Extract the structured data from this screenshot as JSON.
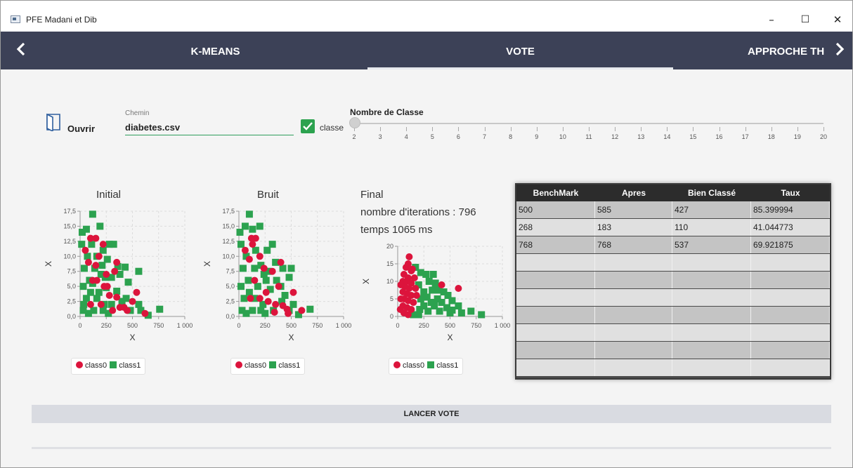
{
  "window": {
    "title": "PFE Madani et Dib",
    "minimize": "–",
    "maximize": "☐",
    "close": "✕"
  },
  "nav": {
    "tabs": [
      "K-MEANS",
      "VOTE",
      "APPROCHE TH"
    ],
    "active_tab": "VOTE",
    "prev_arrow": "‹",
    "next_arrow": "›"
  },
  "controls": {
    "open_label": "Ouvrir",
    "path_caption": "Chemin",
    "path_value": "diabetes.csv",
    "class_checkbox_label": "classe",
    "class_checked": true,
    "slider_title": "Nombre de Classe",
    "slider_min": 2,
    "slider_max": 20,
    "slider_value": 2,
    "slider_ticks": [
      "2",
      "3",
      "4",
      "5",
      "6",
      "7",
      "8",
      "9",
      "10",
      "11",
      "12",
      "13",
      "14",
      "15",
      "16",
      "17",
      "18",
      "19",
      "20"
    ]
  },
  "colors": {
    "accent": "#2ca24f",
    "navbar": "#3c4157",
    "class0": "#dc143c",
    "class1": "#2ca24f"
  },
  "chart_data": [
    {
      "type": "scatter",
      "title": "Initial",
      "xlabel": "X",
      "ylabel": "X",
      "xlim": [
        0,
        1000
      ],
      "ylim": [
        0,
        17.5
      ],
      "x_ticks": [
        "0",
        "250",
        "500",
        "750",
        "1 000"
      ],
      "y_ticks": [
        "0,0",
        "2,5",
        "5,0",
        "7,5",
        "10,0",
        "12,5",
        "15,0",
        "17,5"
      ],
      "grid": true,
      "legend": "bottom",
      "series": [
        {
          "name": "class0",
          "marker": "circle",
          "points": [
            [
              100,
              13
            ],
            [
              150,
              13
            ],
            [
              220,
              12
            ],
            [
              350,
              9
            ],
            [
              180,
              10
            ],
            [
              250,
              7
            ],
            [
              330,
              7.5
            ],
            [
              420,
              1.5
            ],
            [
              540,
              4
            ],
            [
              620,
              0.5
            ],
            [
              280,
              3.5
            ],
            [
              310,
              1
            ],
            [
              450,
              1
            ],
            [
              200,
              2
            ],
            [
              120,
              6
            ],
            [
              230,
              5
            ],
            [
              50,
              11
            ],
            [
              80,
              9
            ],
            [
              160,
              6
            ],
            [
              260,
              5
            ],
            [
              350,
              3.2
            ],
            [
              380,
              1.5
            ],
            [
              100,
              2
            ],
            [
              500,
              2.5
            ],
            [
              150,
              8.5
            ]
          ]
        },
        {
          "name": "class1",
          "marker": "square",
          "points": [
            [
              120,
              17
            ],
            [
              190,
              15
            ],
            [
              20,
              14
            ],
            [
              60,
              14.5
            ],
            [
              110,
              12
            ],
            [
              280,
              12
            ],
            [
              320,
              12
            ],
            [
              220,
              11
            ],
            [
              260,
              9.5
            ],
            [
              360,
              8.3
            ],
            [
              430,
              8.2
            ],
            [
              560,
              7.5
            ],
            [
              380,
              7
            ],
            [
              300,
              6.5
            ],
            [
              460,
              5.7
            ],
            [
              250,
              4.8
            ],
            [
              350,
              4.2
            ],
            [
              440,
              3
            ],
            [
              560,
              2
            ],
            [
              760,
              1.2
            ],
            [
              650,
              0.2
            ],
            [
              70,
              10
            ],
            [
              160,
              10
            ],
            [
              40,
              8
            ],
            [
              140,
              8
            ],
            [
              200,
              7
            ],
            [
              90,
              6
            ],
            [
              180,
              4
            ],
            [
              60,
              3
            ],
            [
              30,
              1
            ],
            [
              130,
              1
            ],
            [
              230,
              2
            ],
            [
              300,
              2
            ],
            [
              400,
              2.5
            ],
            [
              480,
              1
            ],
            [
              580,
              1
            ],
            [
              30,
              5
            ],
            [
              100,
              4
            ],
            [
              160,
              3
            ],
            [
              220,
              1
            ],
            [
              15,
              12
            ],
            [
              35,
              2
            ],
            [
              80,
              0.5
            ],
            [
              120,
              5.5
            ],
            [
              270,
              0.5
            ],
            [
              210,
              8.5
            ],
            [
              240,
              6.5
            ]
          ]
        }
      ]
    },
    {
      "type": "scatter",
      "title": "Bruit",
      "xlabel": "X",
      "ylabel": "X",
      "xlim": [
        0,
        1000
      ],
      "ylim": [
        0,
        17.5
      ],
      "x_ticks": [
        "0",
        "250",
        "500",
        "750",
        "1 000"
      ],
      "y_ticks": [
        "0,0",
        "2,5",
        "5,0",
        "7,5",
        "10,0",
        "12,5",
        "15,0",
        "17,5"
      ],
      "grid": true,
      "legend": "bottom",
      "series": [
        {
          "name": "class0",
          "marker": "circle",
          "points": [
            [
              120,
              13
            ],
            [
              160,
              13
            ],
            [
              130,
              12
            ],
            [
              400,
              9
            ],
            [
              240,
              8
            ],
            [
              320,
              7.5
            ],
            [
              150,
              6
            ],
            [
              380,
              5
            ],
            [
              520,
              4
            ],
            [
              460,
              1.2
            ],
            [
              600,
              1
            ],
            [
              420,
              1.8
            ],
            [
              340,
              0.7
            ],
            [
              280,
              2.5
            ],
            [
              200,
              10
            ],
            [
              100,
              9.5
            ],
            [
              60,
              11
            ],
            [
              260,
              4
            ],
            [
              200,
              3
            ],
            [
              350,
              2
            ],
            [
              110,
              3
            ],
            [
              470,
              0.5
            ]
          ]
        },
        {
          "name": "class1",
          "marker": "square",
          "points": [
            [
              100,
              17
            ],
            [
              60,
              15
            ],
            [
              200,
              15
            ],
            [
              130,
              14.5
            ],
            [
              10,
              14
            ],
            [
              320,
              12
            ],
            [
              270,
              11
            ],
            [
              160,
              11
            ],
            [
              350,
              9
            ],
            [
              420,
              8
            ],
            [
              500,
              8
            ],
            [
              280,
              7.5
            ],
            [
              480,
              6.5
            ],
            [
              360,
              6
            ],
            [
              300,
              4.5
            ],
            [
              400,
              5
            ],
            [
              440,
              3.5
            ],
            [
              520,
              2
            ],
            [
              680,
              1.2
            ],
            [
              570,
              0.3
            ],
            [
              70,
              10
            ],
            [
              40,
              8
            ],
            [
              150,
              8
            ],
            [
              240,
              7
            ],
            [
              90,
              6
            ],
            [
              180,
              5
            ],
            [
              50,
              3
            ],
            [
              30,
              1
            ],
            [
              130,
              1
            ],
            [
              230,
              2
            ],
            [
              330,
              1
            ],
            [
              410,
              2.5
            ],
            [
              480,
              1
            ],
            [
              20,
              5
            ],
            [
              100,
              4
            ],
            [
              150,
              3
            ],
            [
              210,
              1
            ],
            [
              20,
              12
            ],
            [
              70,
              0.5
            ],
            [
              250,
              0.5
            ],
            [
              210,
              8.5
            ],
            [
              260,
              6
            ]
          ]
        }
      ]
    },
    {
      "type": "scatter",
      "title": "Final",
      "subtitle_lines": [
        "nombre d'iterations : 796",
        "temps 1065 ms"
      ],
      "xlabel": "X",
      "ylabel": "X",
      "xlim": [
        0,
        1000
      ],
      "ylim": [
        0,
        20
      ],
      "x_ticks": [
        "0",
        "250",
        "500",
        "750",
        "1 000"
      ],
      "y_ticks": [
        "0",
        "5",
        "10",
        "15",
        "20"
      ],
      "grid": true,
      "legend": "bottom",
      "series": [
        {
          "name": "class0",
          "marker": "circle",
          "points": [
            [
              110,
              17
            ],
            [
              100,
              15
            ],
            [
              80,
              14
            ],
            [
              130,
              13
            ],
            [
              60,
              12
            ],
            [
              100,
              11
            ],
            [
              50,
              10
            ],
            [
              90,
              10
            ],
            [
              130,
              9.5
            ],
            [
              70,
              8.5
            ],
            [
              110,
              8
            ],
            [
              50,
              7
            ],
            [
              90,
              6.5
            ],
            [
              130,
              6
            ],
            [
              60,
              5
            ],
            [
              100,
              4.5
            ],
            [
              50,
              3
            ],
            [
              90,
              2.5
            ],
            [
              130,
              2
            ],
            [
              60,
              1
            ],
            [
              100,
              0.5
            ],
            [
              160,
              11
            ],
            [
              170,
              8
            ],
            [
              180,
              6
            ],
            [
              30,
              9
            ],
            [
              30,
              5
            ],
            [
              25,
              2
            ],
            [
              420,
              9
            ],
            [
              580,
              8
            ],
            [
              150,
              4
            ],
            [
              140,
              13.5
            ]
          ]
        },
        {
          "name": "class1",
          "marker": "square",
          "points": [
            [
              170,
              14
            ],
            [
              220,
              12.5
            ],
            [
              270,
              12
            ],
            [
              340,
              12
            ],
            [
              300,
              10
            ],
            [
              200,
              9
            ],
            [
              360,
              9.5
            ],
            [
              380,
              7.5
            ],
            [
              250,
              7
            ],
            [
              330,
              7.5
            ],
            [
              440,
              7
            ],
            [
              280,
              5.5
            ],
            [
              380,
              5
            ],
            [
              480,
              6
            ],
            [
              320,
              4
            ],
            [
              420,
              4
            ],
            [
              520,
              4.5
            ],
            [
              250,
              3
            ],
            [
              350,
              3
            ],
            [
              470,
              2.5
            ],
            [
              580,
              3
            ],
            [
              290,
              1.5
            ],
            [
              400,
              1.5
            ],
            [
              500,
              1
            ],
            [
              610,
              1
            ],
            [
              700,
              1.5
            ],
            [
              800,
              0.5
            ],
            [
              220,
              5
            ],
            [
              210,
              2
            ],
            [
              200,
              0.5
            ],
            [
              520,
              1.8
            ],
            [
              150,
              0.5
            ]
          ]
        }
      ]
    }
  ],
  "table": {
    "columns": [
      "BenchMark",
      "Apres",
      "Bien Classé",
      "Taux"
    ],
    "rows": [
      [
        "500",
        "585",
        "427",
        "85.399994"
      ],
      [
        "268",
        "183",
        "110",
        "41.044773"
      ],
      [
        "768",
        "768",
        "537",
        "69.921875"
      ]
    ],
    "empty_rows": 7
  },
  "launch_button": "LANCER VOTE"
}
